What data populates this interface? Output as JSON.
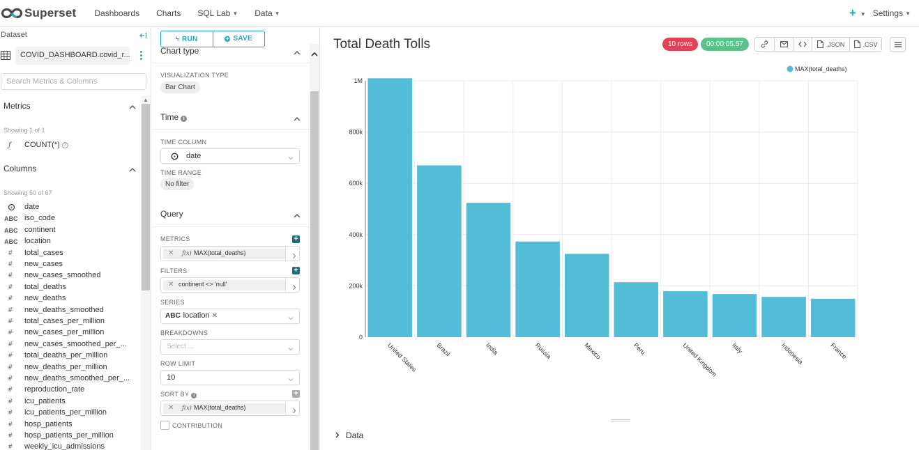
{
  "navbar": {
    "brand": "Superset",
    "items": [
      {
        "label": "Dashboards",
        "dropdown": false
      },
      {
        "label": "Charts",
        "dropdown": false
      },
      {
        "label": "SQL Lab",
        "dropdown": true
      },
      {
        "label": "Data",
        "dropdown": true
      }
    ],
    "settings_label": "Settings",
    "accent_color": "#20a7c9"
  },
  "dataset_panel": {
    "title": "Dataset",
    "dataset_name": "COVID_DASHBOARD.covid_r...",
    "search_placeholder": "Search Metrics & Columns",
    "metrics_header": "Metrics",
    "metrics_showing": "Showing 1 of 1",
    "metrics": [
      {
        "label": "COUNT(*)",
        "icon": "function-icon"
      }
    ],
    "columns_header": "Columns",
    "columns_showing": "Showing 50 of 67",
    "columns": [
      {
        "type": "clock",
        "name": "date"
      },
      {
        "type": "ABC",
        "name": "iso_code"
      },
      {
        "type": "ABC",
        "name": "continent"
      },
      {
        "type": "ABC",
        "name": "location"
      },
      {
        "type": "#",
        "name": "total_cases"
      },
      {
        "type": "#",
        "name": "new_cases"
      },
      {
        "type": "#",
        "name": "new_cases_smoothed"
      },
      {
        "type": "#",
        "name": "total_deaths"
      },
      {
        "type": "#",
        "name": "new_deaths"
      },
      {
        "type": "#",
        "name": "new_deaths_smoothed"
      },
      {
        "type": "#",
        "name": "total_cases_per_million"
      },
      {
        "type": "#",
        "name": "new_cases_per_million"
      },
      {
        "type": "#",
        "name": "new_cases_smoothed_per_..."
      },
      {
        "type": "#",
        "name": "total_deaths_per_million"
      },
      {
        "type": "#",
        "name": "new_deaths_per_million"
      },
      {
        "type": "#",
        "name": "new_deaths_smoothed_per_..."
      },
      {
        "type": "#",
        "name": "reproduction_rate"
      },
      {
        "type": "#",
        "name": "icu_patients"
      },
      {
        "type": "#",
        "name": "icu_patients_per_million"
      },
      {
        "type": "#",
        "name": "hosp_patients"
      },
      {
        "type": "#",
        "name": "hosp_patients_per_million"
      },
      {
        "type": "#",
        "name": "weekly_icu_admissions"
      }
    ]
  },
  "control_panel": {
    "run_label": "RUN",
    "save_label": "SAVE",
    "chart_type_header": "Chart type",
    "viz_type_label": "VISUALIZATION TYPE",
    "viz_type_value": "Bar Chart",
    "time_header": "Time",
    "time_column_label": "TIME COLUMN",
    "time_column_value": "date",
    "time_range_label": "TIME RANGE",
    "time_range_value": "No filter",
    "query_header": "Query",
    "metrics_label": "METRICS",
    "metrics_value": "MAX(total_deaths)",
    "filters_label": "FILTERS",
    "filters_value": "continent <> 'null'",
    "series_label": "SERIES",
    "series_type": "ABC",
    "series_value": "location",
    "breakdowns_label": "BREAKDOWNS",
    "breakdowns_placeholder": "Select ...",
    "row_limit_label": "ROW LIMIT",
    "row_limit_value": "10",
    "sort_by_label": "SORT BY",
    "sort_by_value": "MAX(total_deaths)",
    "contribution_label": "CONTRIBUTION"
  },
  "chart_panel": {
    "title": "Total Death Tolls",
    "rows_badge": "10 rows",
    "time_badge": "00:00:05.57",
    "json_label": ".JSON",
    "csv_label": ".CSV",
    "data_toggle_label": "Data",
    "rows_badge_color": "#e04355",
    "time_badge_color": "#5ac189"
  },
  "chart_data": {
    "type": "bar",
    "title": "Total Death Tolls",
    "categories": [
      "United States",
      "Brazil",
      "India",
      "Russia",
      "Mexico",
      "Peru",
      "United Kingdom",
      "Italy",
      "Indonesia",
      "France"
    ],
    "series": [
      {
        "name": "MAX(total_deaths)",
        "values": [
          1010000,
          670000,
          524000,
          373000,
          325000,
          214000,
          179000,
          168000,
          157000,
          150000
        ],
        "color": "#53bcd7"
      }
    ],
    "ylim": [
      0,
      1000000
    ],
    "yticks": [
      0,
      200000,
      400000,
      600000,
      800000,
      1000000
    ],
    "ytick_labels": [
      "0",
      "200k",
      "400k",
      "600k",
      "800k",
      "1M"
    ],
    "xlabel": "",
    "ylabel": "",
    "grid": true,
    "legend": "top-right"
  }
}
